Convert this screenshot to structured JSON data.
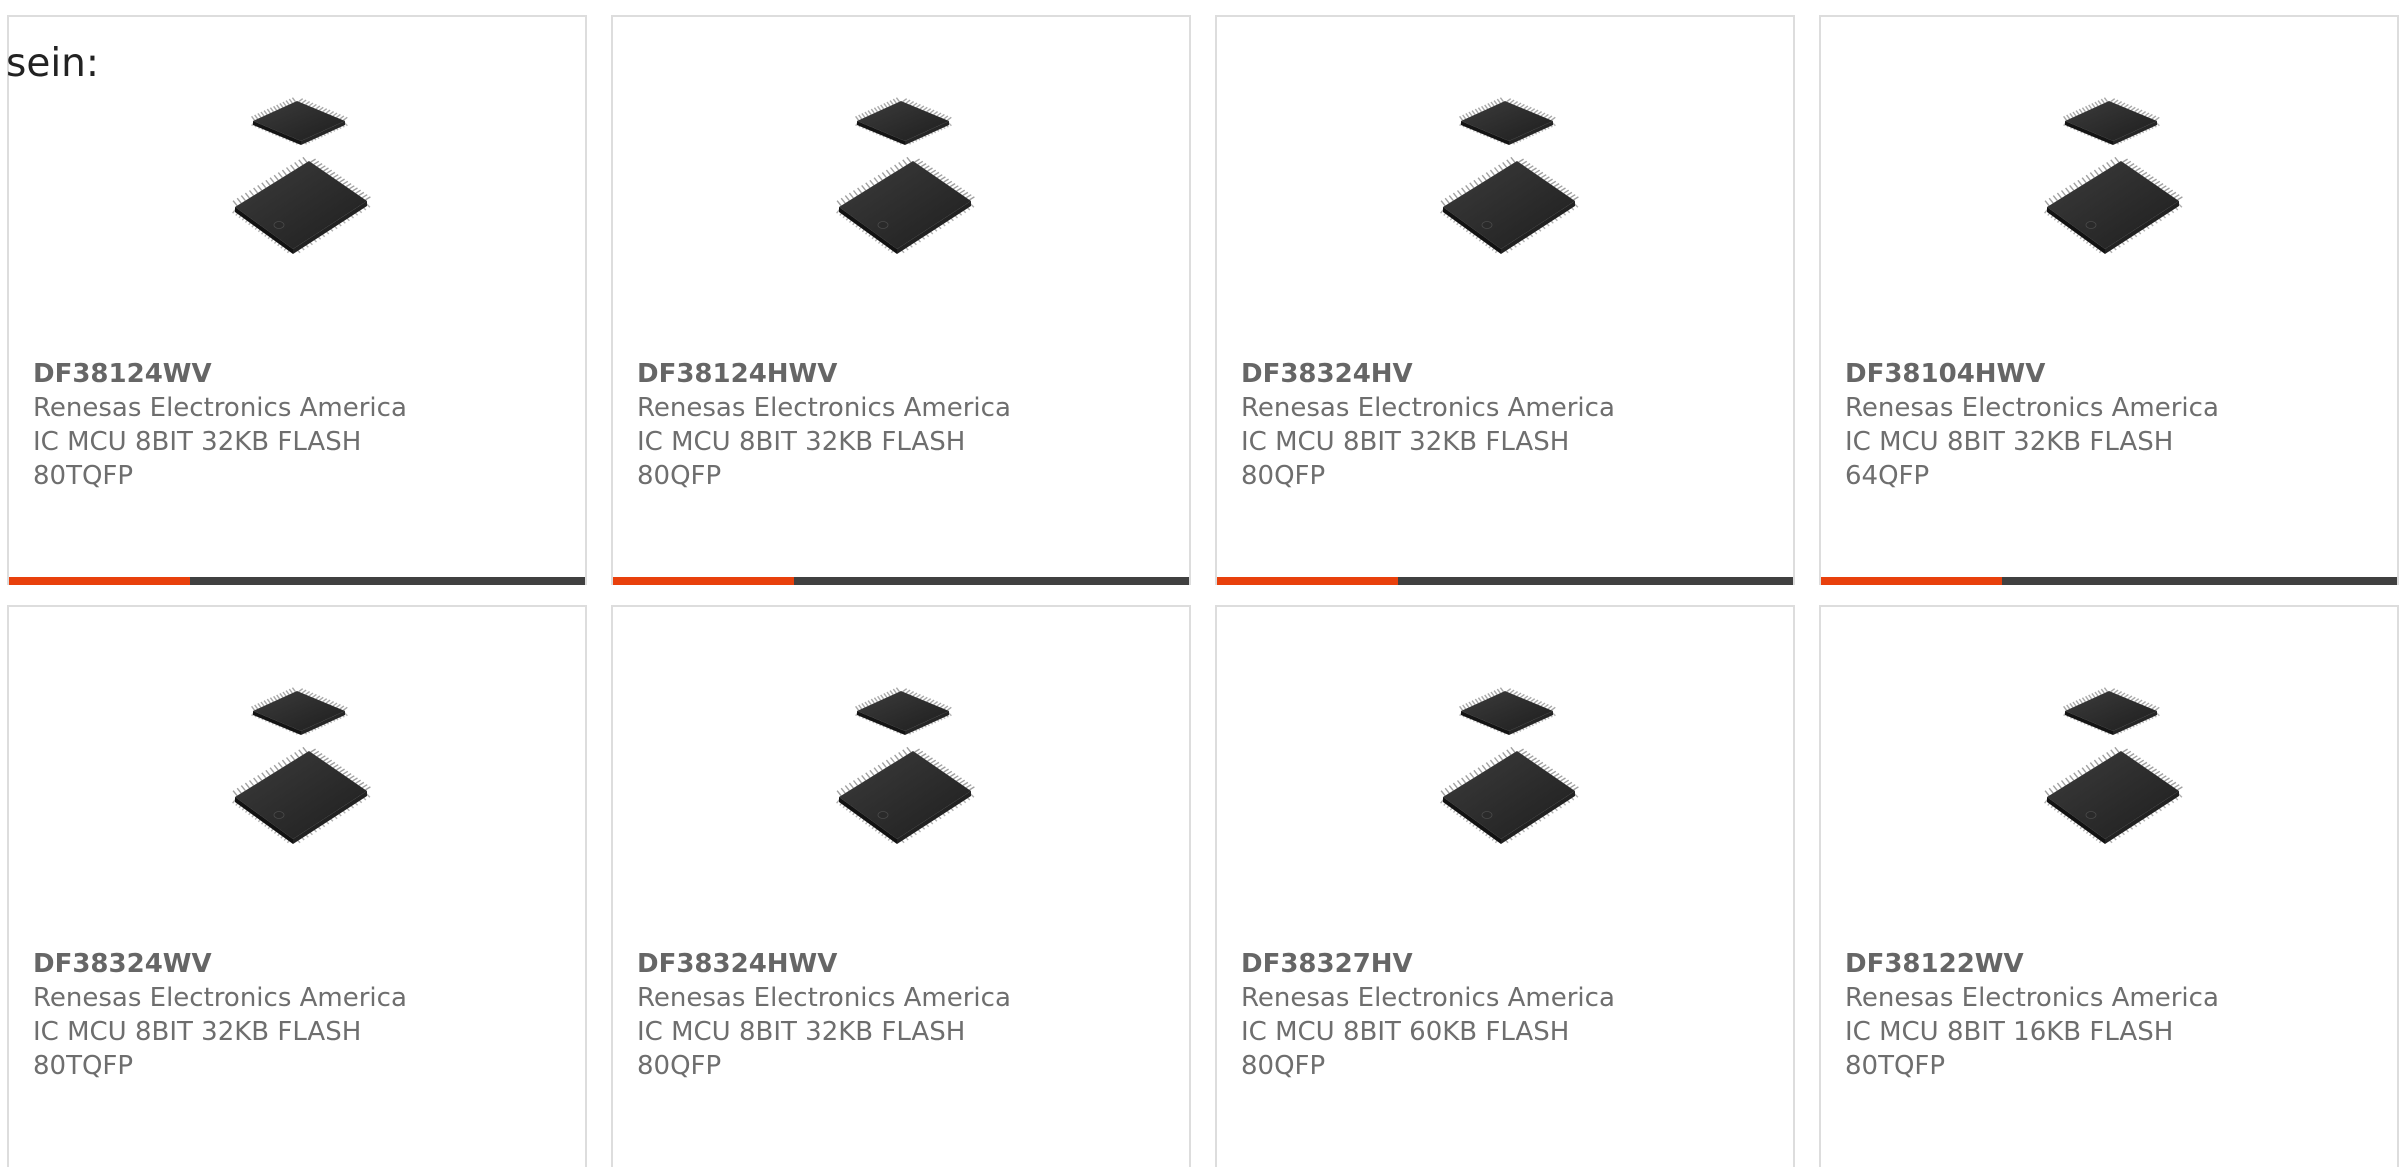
{
  "intro_text": "sein:",
  "colors": {
    "accent": "#e8400c",
    "bar": "#404040",
    "border": "#dddddd",
    "text": "#6e6e6e"
  },
  "products": [
    {
      "part_number": "DF38124WV",
      "manufacturer": "Renesas Electronics America",
      "description": "IC MCU 8BIT 32KB FLASH 80TQFP",
      "image_icon": "ic-chip-qfp-icon"
    },
    {
      "part_number": "DF38124HWV",
      "manufacturer": "Renesas Electronics America",
      "description": "IC MCU 8BIT 32KB FLASH 80QFP",
      "image_icon": "ic-chip-qfp-icon"
    },
    {
      "part_number": "DF38324HV",
      "manufacturer": "Renesas Electronics America",
      "description": "IC MCU 8BIT 32KB FLASH 80QFP",
      "image_icon": "ic-chip-qfp-icon"
    },
    {
      "part_number": "DF38104HWV",
      "manufacturer": "Renesas Electronics America",
      "description": "IC MCU 8BIT 32KB FLASH 64QFP",
      "image_icon": "ic-chip-qfp-icon"
    },
    {
      "part_number": "DF38324WV",
      "manufacturer": "Renesas Electronics America",
      "description": "IC MCU 8BIT 32KB FLASH 80TQFP",
      "image_icon": "ic-chip-qfp-icon"
    },
    {
      "part_number": "DF38324HWV",
      "manufacturer": "Renesas Electronics America",
      "description": "IC MCU 8BIT 32KB FLASH 80QFP",
      "image_icon": "ic-chip-qfp-icon"
    },
    {
      "part_number": "DF38327HV",
      "manufacturer": "Renesas Electronics America",
      "description": "IC MCU 8BIT 60KB FLASH 80QFP",
      "image_icon": "ic-chip-qfp-icon"
    },
    {
      "part_number": "DF38122WV",
      "manufacturer": "Renesas Electronics America",
      "description": "IC MCU 8BIT 16KB FLASH 80TQFP",
      "image_icon": "ic-chip-qfp-icon"
    }
  ]
}
